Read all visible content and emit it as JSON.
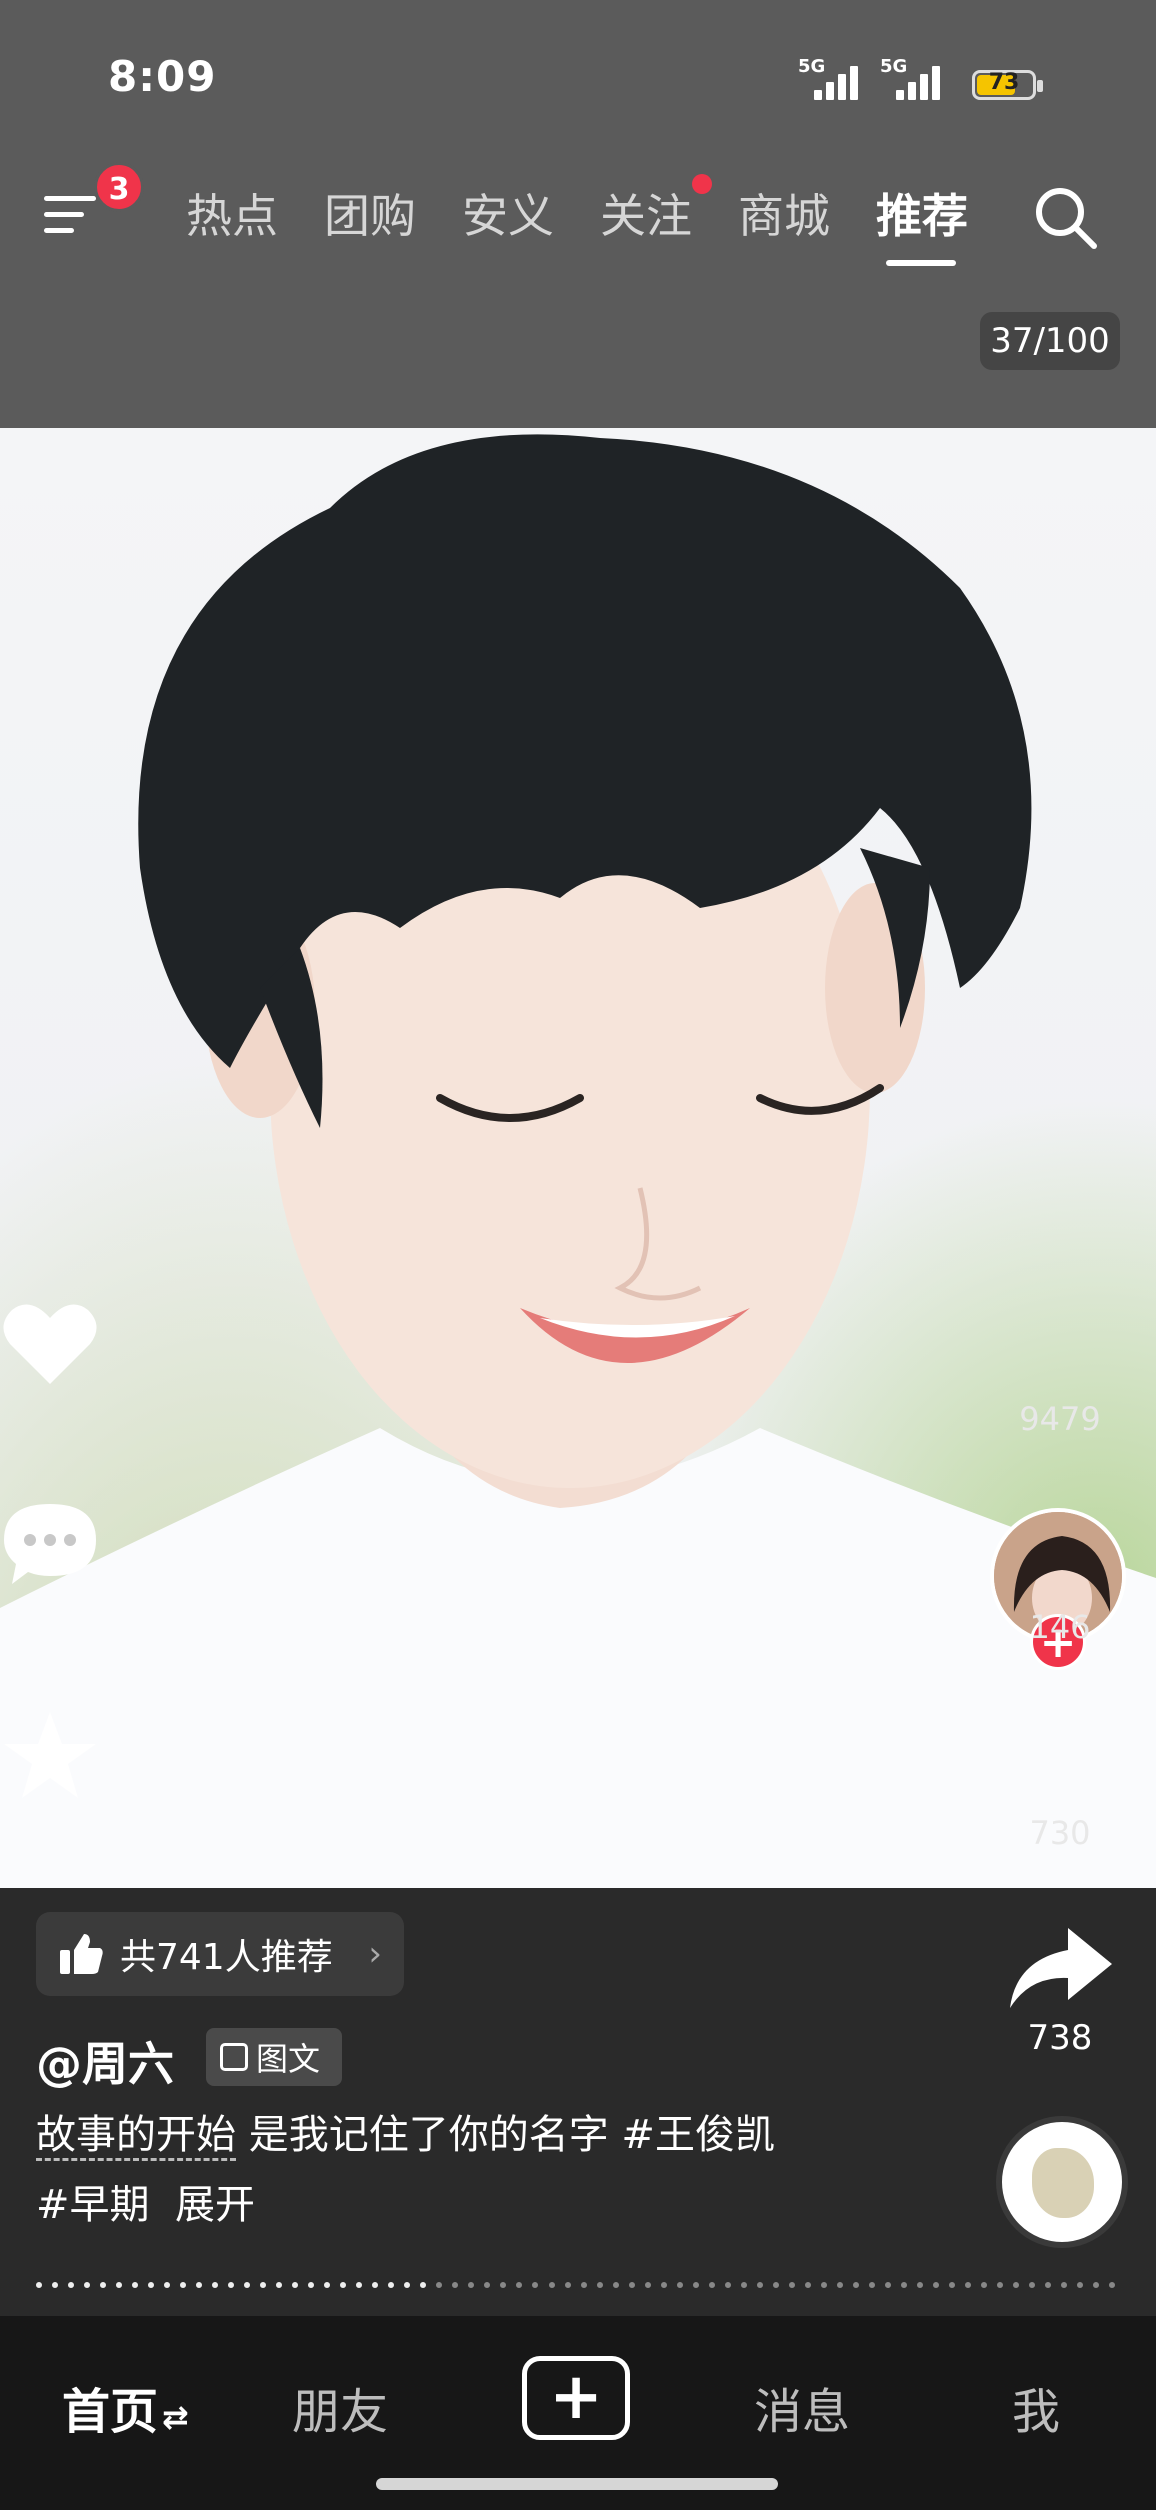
{
  "status_bar": {
    "time": "8:09",
    "network_1": "5G",
    "network_2": "5G",
    "battery": "73"
  },
  "top_nav": {
    "menu_badge": "3",
    "tabs": [
      {
        "label": "热点"
      },
      {
        "label": "团购"
      },
      {
        "label": "安义"
      },
      {
        "label": "关注"
      },
      {
        "label": "商城"
      },
      {
        "label": "推荐"
      }
    ],
    "active_tab": "推荐",
    "photo_counter": "37/100"
  },
  "side_actions": {
    "likes": "9479",
    "comments": "146",
    "favorites": "730",
    "shares": "738"
  },
  "post": {
    "recommend_text": "共741人推荐",
    "author": "@周六",
    "type_tag": "图文",
    "caption_underlined": "故事的开始",
    "caption_rest": " 是我记住了你的名字 #王俊凯",
    "caption_line2": "#早期",
    "expand_label": "展开"
  },
  "bottom_nav": {
    "home": "首页",
    "friends": "朋友",
    "messages": "消息",
    "me": "我"
  },
  "colors": {
    "accent_red": "#f0344a",
    "top_bg": "#5b5b5b",
    "info_bg": "#2a2a2a",
    "tabbar_bg": "#171717"
  }
}
